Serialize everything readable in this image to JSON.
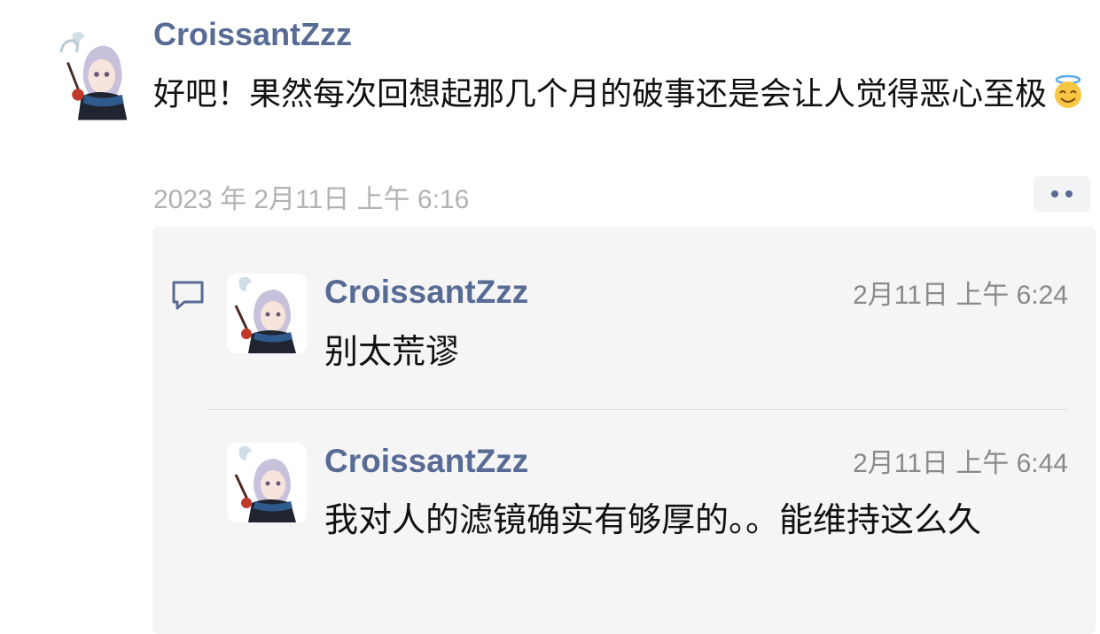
{
  "post": {
    "author": "CroissantZzz",
    "text": "好吧！果然每次回想起那几个月的破事还是会让人觉得恶心至极",
    "emoji_icon": "smiling-face-with-halo-icon",
    "timestamp": "2023 年 2月11日 上午 6:16",
    "more_icon": "more-dots-icon"
  },
  "comments_section": {
    "icon": "comment-bubble-icon",
    "items": [
      {
        "author": "CroissantZzz",
        "time": "2月11日 上午 6:24",
        "text": "别太荒谬"
      },
      {
        "author": "CroissantZzz",
        "time": "2月11日 上午 6:44",
        "text": "我对人的滤镜确实有够厚的。。能维持这么久"
      }
    ]
  },
  "colors": {
    "name_link": "#576b95",
    "timestamp": "#b2b2b2",
    "comment_bg": "#f5f5f5"
  }
}
